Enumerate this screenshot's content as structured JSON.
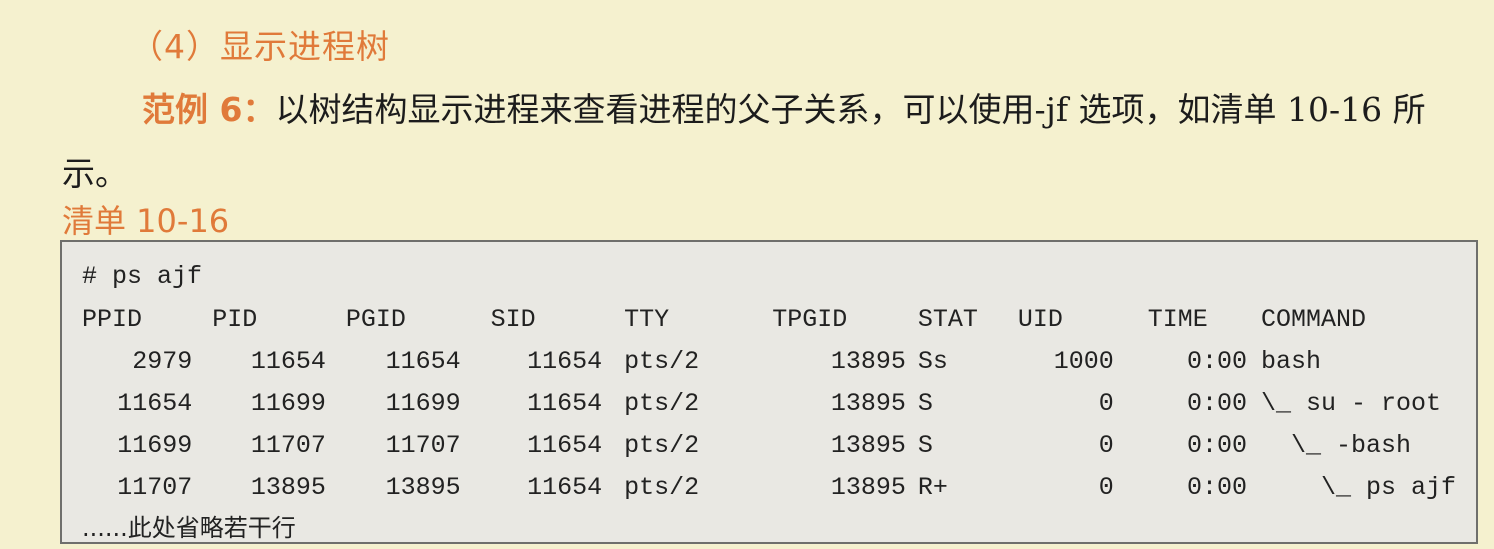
{
  "heading": "（4）显示进程树",
  "paragraph": {
    "example_label": "范例 6：",
    "text": "以树结构显示进程来查看进程的父子关系，可以使用-jf 选项，如清单 10-16 所示。"
  },
  "listing_title": "清单 10-16",
  "code": {
    "command": "# ps ajf",
    "columns": [
      "PPID",
      "PID",
      "PGID",
      "SID",
      "TTY",
      "TPGID",
      "STAT",
      "UID",
      "TIME",
      "COMMAND"
    ],
    "rows": [
      [
        "2979",
        "11654",
        "11654",
        "11654",
        "pts/2",
        "13895",
        "Ss",
        "1000",
        "0:00",
        "bash"
      ],
      [
        "11654",
        "11699",
        "11699",
        "11654",
        "pts/2",
        "13895",
        "S",
        "0",
        "0:00",
        "\\_ su - root"
      ],
      [
        "11699",
        "11707",
        "11707",
        "11654",
        "pts/2",
        "13895",
        "S",
        "0",
        "0:00",
        "  \\_ -bash"
      ],
      [
        "11707",
        "13895",
        "13895",
        "11654",
        "pts/2",
        "13895",
        "R+",
        "0",
        "0:00",
        "    \\_ ps ajf"
      ]
    ],
    "footer_note": "......此处省略若干行"
  }
}
